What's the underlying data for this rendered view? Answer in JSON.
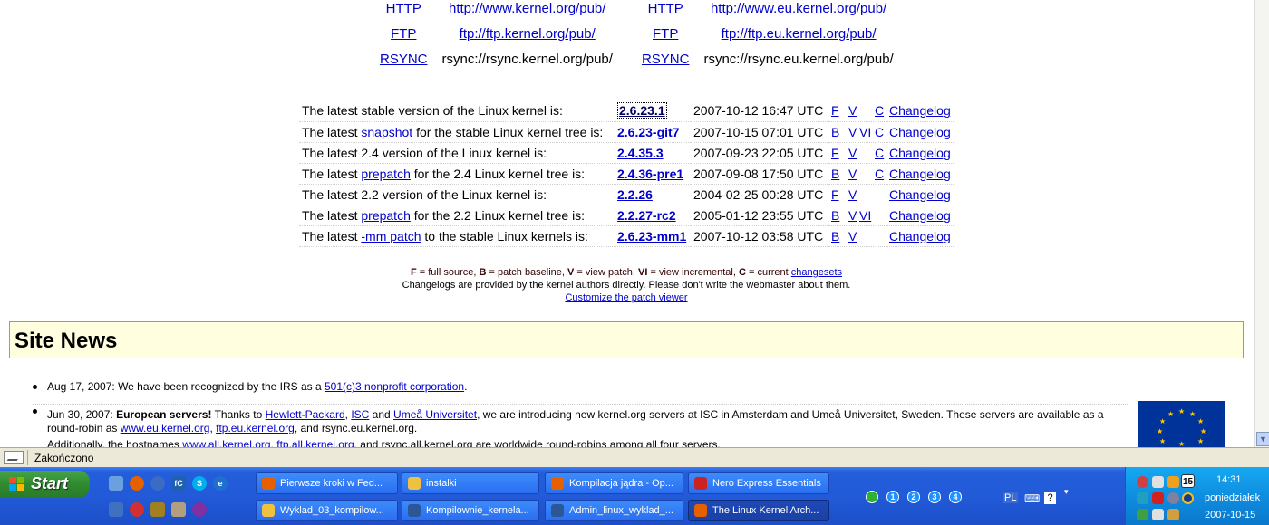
{
  "mirrors": [
    {
      "proto": "HTTP",
      "url": "http://www.kernel.org/pub/",
      "url_is_link": true,
      "eu_proto": "HTTP",
      "eu_url": "http://www.eu.kernel.org/pub/",
      "eu_url_is_link": true
    },
    {
      "proto": "FTP",
      "url": "ftp://ftp.kernel.org/pub/",
      "url_is_link": true,
      "eu_proto": "FTP",
      "eu_url": "ftp://ftp.eu.kernel.org/pub/",
      "eu_url_is_link": true
    },
    {
      "proto": "RSYNC",
      "url": "rsync://rsync.kernel.org/pub/",
      "url_is_link": false,
      "eu_proto": "RSYNC",
      "eu_url": "rsync://rsync.eu.kernel.org/pub/",
      "eu_url_is_link": false
    }
  ],
  "releases": [
    {
      "pre": "The latest stable version of the Linux kernel is:",
      "link": "",
      "post": "",
      "version": "2.6.23.1",
      "date": "2007-10-12 16:47 UTC",
      "b": "",
      "f": "F",
      "v": "V",
      "vi": "",
      "c": "C",
      "changelog": "Changelog"
    },
    {
      "pre": "The latest ",
      "link": "snapshot",
      "post": " for the stable Linux kernel tree is:",
      "version": "2.6.23-git7",
      "date": "2007-10-15 07:01 UTC",
      "b": "B",
      "f": "",
      "v": "V",
      "vi": "VI",
      "c": "C",
      "changelog": "Changelog"
    },
    {
      "pre": "The latest 2.4 version of the Linux kernel is:",
      "link": "",
      "post": "",
      "version": "2.4.35.3",
      "date": "2007-09-23 22:05 UTC",
      "b": "",
      "f": "F",
      "v": "V",
      "vi": "",
      "c": "C",
      "changelog": "Changelog"
    },
    {
      "pre": "The latest ",
      "link": "prepatch",
      "post": " for the 2.4 Linux kernel tree is:",
      "version": "2.4.36-pre1",
      "date": "2007-09-08 17:50 UTC",
      "b": "B",
      "f": "",
      "v": "V",
      "vi": "",
      "c": "C",
      "changelog": "Changelog"
    },
    {
      "pre": "The latest 2.2 version of the Linux kernel is:",
      "link": "",
      "post": "",
      "version": "2.2.26",
      "date": "2004-02-25 00:28 UTC",
      "b": "",
      "f": "F",
      "v": "V",
      "vi": "",
      "c": "",
      "changelog": "Changelog"
    },
    {
      "pre": "The latest ",
      "link": "prepatch",
      "post": " for the 2.2 Linux kernel tree is:",
      "version": "2.2.27-rc2",
      "date": "2005-01-12 23:55 UTC",
      "b": "B",
      "f": "",
      "v": "V",
      "vi": "VI",
      "c": "",
      "changelog": "Changelog"
    },
    {
      "pre": "The latest ",
      "link": "-mm patch",
      "post": " to the stable Linux kernels is:",
      "version": "2.6.23-mm1",
      "date": "2007-10-12 03:58 UTC",
      "b": "B",
      "f": "",
      "v": "V",
      "vi": "",
      "c": "",
      "changelog": "Changelog"
    }
  ],
  "legend": {
    "line1_parts": [
      "F",
      " = full source, ",
      "B",
      " = patch baseline, ",
      "V",
      " = view patch, ",
      "VI",
      " = view incremental, ",
      "C",
      " = current "
    ],
    "changesets": "changesets",
    "line2": "Changelogs are provided by the kernel authors directly. Please don't write the webmaster about them.",
    "line3": "Customize the patch viewer"
  },
  "site_news": {
    "title": "Site News",
    "item1": {
      "pre": "Aug 17, 2007: We have been recognized by the IRS as a ",
      "link": "501(c)3 nonprofit corporation",
      "post": "."
    },
    "item2": {
      "date": "Jun 30, 2007: ",
      "headline": "European servers!",
      "t1": " Thanks to ",
      "l1": "Hewlett-Packard",
      "t2": ", ",
      "l2": "ISC",
      "t3": " and ",
      "l3": "Umeå Universitet",
      "t4": ", we are introducing new kernel.org servers at ISC in Amsterdam and Umeå Universitet, Sweden. These servers are available as a round-robin as ",
      "l4": "www.eu.kernel.org",
      "t5": ", ",
      "l5": "ftp.eu.kernel.org",
      "t6": ", and rsync.eu.kernel.org.",
      "add_pre": "Additionally, the hostnames ",
      "al1": "www.all.kernel.org",
      "at1": ", ",
      "al2": "ftp.all.kernel.org",
      "at2": ", and rsync.all.kernel.org are worldwide round-robins among all four servers."
    }
  },
  "status": {
    "text": "Zakończono"
  },
  "taskbar": {
    "start_label": "Start",
    "tasks": [
      {
        "label": "Pierwsze kroki w Fed...",
        "icon_color": "#e66000"
      },
      {
        "label": "instalki",
        "icon_color": "#f0c040"
      },
      {
        "label": "Kompilacja jądra - Op...",
        "icon_color": "#e66000"
      },
      {
        "label": "Nero Express Essentials",
        "icon_color": "#cc2222"
      },
      {
        "label": "Wyklad_03_kompilow...",
        "icon_color": "#f0c040"
      },
      {
        "label": "Kompilownie_kernela...",
        "icon_color": "#2b5797"
      },
      {
        "label": "Admin_linux_wyklad_...",
        "icon_color": "#2b5797"
      },
      {
        "label": "The Linux Kernel Arch...",
        "icon_color": "#e66000"
      }
    ],
    "desktops": [
      "1",
      "2",
      "3",
      "4"
    ],
    "lang": "PL",
    "clock_time": "14:31",
    "clock_day": "poniedziałek",
    "clock_date": "2007-10-15",
    "tray_calendar": "15"
  }
}
